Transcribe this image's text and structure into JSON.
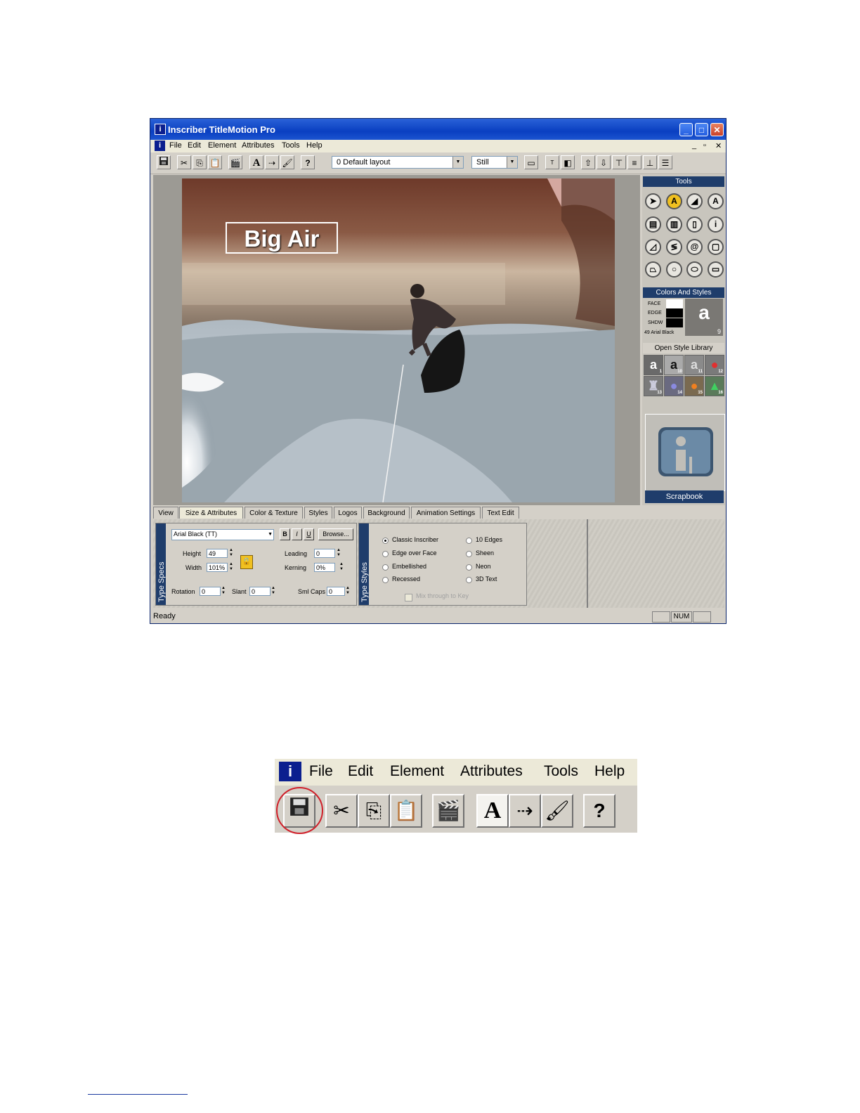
{
  "window": {
    "title": "Inscriber TitleMotion Pro",
    "app_icon_glyph": "i",
    "min_glyph": "_",
    "max_glyph": "□",
    "close_glyph": "✕"
  },
  "menu": {
    "items": [
      "File",
      "Edit",
      "Element",
      "Attributes",
      "Tools",
      "Help"
    ],
    "mdi_controls": [
      "_",
      "▫",
      "✕"
    ]
  },
  "toolbar": {
    "layout_value": "0 Default layout",
    "mode_value": "Still",
    "help_glyph": "?",
    "text_tool_glyph": "A"
  },
  "canvas": {
    "title_text": "Big Air"
  },
  "tools_panel": {
    "header": "Tools",
    "colors_header": "Colors And Styles",
    "face_label": "FACE",
    "edge_label": "EDGE",
    "shadow_label": "SHDW",
    "font_caption": "49 Arial Black",
    "preview_letter": "a",
    "preview_num": "9",
    "library_header": "Open Style Library",
    "style_numbers": [
      "1",
      "10",
      "11",
      "12",
      "13",
      "14",
      "15",
      "16"
    ],
    "scrapbook_label": "Scrapbook"
  },
  "tabs": [
    "View",
    "Size & Attributes",
    "Color & Texture",
    "Styles",
    "Logos",
    "Background",
    "Animation Settings",
    "Text Edit"
  ],
  "type_specs": {
    "group_label": "Type Specs",
    "font": "Arial Black (TT)",
    "bold": "B",
    "italic": "I",
    "underline": "U",
    "browse": "Browse...",
    "height_label": "Height",
    "height_value": "49",
    "width_label": "Width",
    "width_value": "101%",
    "leading_label": "Leading",
    "leading_value": "0",
    "kerning_label": "Kerning",
    "kerning_value": "0%",
    "rotation_label": "Rotation",
    "rotation_value": "0",
    "slant_label": "Slant",
    "slant_value": "0",
    "smlcaps_label": "Sml Caps",
    "smlcaps_value": "0"
  },
  "type_styles": {
    "group_label": "Type Styles",
    "options_left": [
      "Classic Inscriber",
      "Edge over Face",
      "Embellished",
      "Recessed"
    ],
    "options_right": [
      "10 Edges",
      "Sheen",
      "Neon",
      "3D Text"
    ],
    "selected": "Classic Inscriber",
    "mix_label": "Mix through to Key"
  },
  "status": {
    "text": "Ready",
    "num": "NUM"
  },
  "zoom_callout": {
    "menu_items": [
      "File",
      "Edit",
      "Element",
      "Attributes",
      "Tools",
      "Help"
    ],
    "help_glyph": "?",
    "text_glyph": "A"
  }
}
